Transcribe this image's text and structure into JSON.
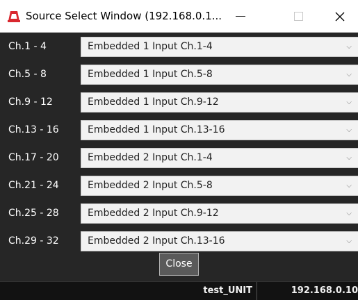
{
  "window": {
    "title": "Source Select Window (192.168.0.1...",
    "icon": "app-logo-icon",
    "controls": {
      "minimize": "minimize-icon",
      "maximize": "maximize-icon",
      "close": "close-icon"
    }
  },
  "channels": [
    {
      "label": "Ch.1 - 4",
      "source": "Embedded 1 Input Ch.1-4"
    },
    {
      "label": "Ch.5 - 8",
      "source": "Embedded 1 Input Ch.5-8"
    },
    {
      "label": "Ch.9 - 12",
      "source": "Embedded 1 Input Ch.9-12"
    },
    {
      "label": "Ch.13 - 16",
      "source": "Embedded 1 Input Ch.13-16"
    },
    {
      "label": "Ch.17 - 20",
      "source": "Embedded 2 Input Ch.1-4"
    },
    {
      "label": "Ch.21 - 24",
      "source": "Embedded 2 Input Ch.5-8"
    },
    {
      "label": "Ch.25 - 28",
      "source": "Embedded 2 Input Ch.9-12"
    },
    {
      "label": "Ch.29 - 32",
      "source": "Embedded 2 Input Ch.13-16"
    }
  ],
  "close_label": "Close",
  "status": {
    "unit_name": "test_UNIT",
    "ip": "192.168.0.10"
  },
  "colors": {
    "background": "#262626",
    "statusbar": "#121212",
    "accent": "#d9282f"
  }
}
